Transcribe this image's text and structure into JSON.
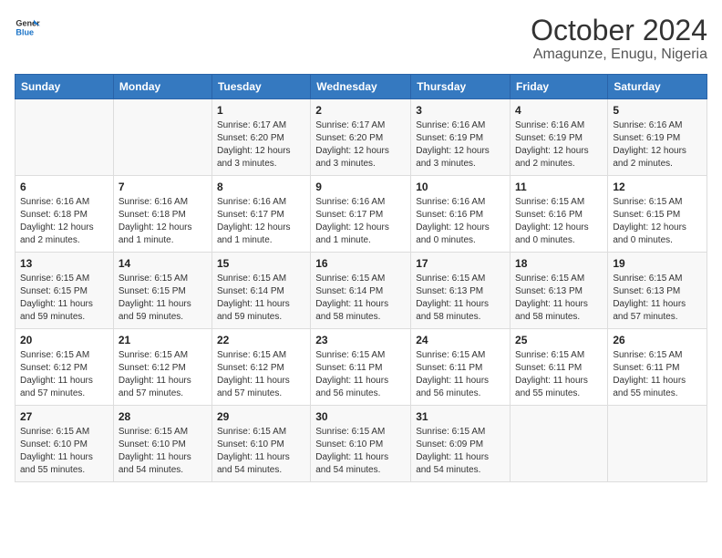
{
  "logo": {
    "line1": "General",
    "line2": "Blue"
  },
  "title": {
    "month_year": "October 2024",
    "location": "Amagunze, Enugu, Nigeria"
  },
  "header_days": [
    "Sunday",
    "Monday",
    "Tuesday",
    "Wednesday",
    "Thursday",
    "Friday",
    "Saturday"
  ],
  "weeks": [
    [
      {
        "day": "",
        "info": ""
      },
      {
        "day": "",
        "info": ""
      },
      {
        "day": "1",
        "info": "Sunrise: 6:17 AM\nSunset: 6:20 PM\nDaylight: 12 hours and 3 minutes."
      },
      {
        "day": "2",
        "info": "Sunrise: 6:17 AM\nSunset: 6:20 PM\nDaylight: 12 hours and 3 minutes."
      },
      {
        "day": "3",
        "info": "Sunrise: 6:16 AM\nSunset: 6:19 PM\nDaylight: 12 hours and 3 minutes."
      },
      {
        "day": "4",
        "info": "Sunrise: 6:16 AM\nSunset: 6:19 PM\nDaylight: 12 hours and 2 minutes."
      },
      {
        "day": "5",
        "info": "Sunrise: 6:16 AM\nSunset: 6:19 PM\nDaylight: 12 hours and 2 minutes."
      }
    ],
    [
      {
        "day": "6",
        "info": "Sunrise: 6:16 AM\nSunset: 6:18 PM\nDaylight: 12 hours and 2 minutes."
      },
      {
        "day": "7",
        "info": "Sunrise: 6:16 AM\nSunset: 6:18 PM\nDaylight: 12 hours and 1 minute."
      },
      {
        "day": "8",
        "info": "Sunrise: 6:16 AM\nSunset: 6:17 PM\nDaylight: 12 hours and 1 minute."
      },
      {
        "day": "9",
        "info": "Sunrise: 6:16 AM\nSunset: 6:17 PM\nDaylight: 12 hours and 1 minute."
      },
      {
        "day": "10",
        "info": "Sunrise: 6:16 AM\nSunset: 6:16 PM\nDaylight: 12 hours and 0 minutes."
      },
      {
        "day": "11",
        "info": "Sunrise: 6:15 AM\nSunset: 6:16 PM\nDaylight: 12 hours and 0 minutes."
      },
      {
        "day": "12",
        "info": "Sunrise: 6:15 AM\nSunset: 6:15 PM\nDaylight: 12 hours and 0 minutes."
      }
    ],
    [
      {
        "day": "13",
        "info": "Sunrise: 6:15 AM\nSunset: 6:15 PM\nDaylight: 11 hours and 59 minutes."
      },
      {
        "day": "14",
        "info": "Sunrise: 6:15 AM\nSunset: 6:15 PM\nDaylight: 11 hours and 59 minutes."
      },
      {
        "day": "15",
        "info": "Sunrise: 6:15 AM\nSunset: 6:14 PM\nDaylight: 11 hours and 59 minutes."
      },
      {
        "day": "16",
        "info": "Sunrise: 6:15 AM\nSunset: 6:14 PM\nDaylight: 11 hours and 58 minutes."
      },
      {
        "day": "17",
        "info": "Sunrise: 6:15 AM\nSunset: 6:13 PM\nDaylight: 11 hours and 58 minutes."
      },
      {
        "day": "18",
        "info": "Sunrise: 6:15 AM\nSunset: 6:13 PM\nDaylight: 11 hours and 58 minutes."
      },
      {
        "day": "19",
        "info": "Sunrise: 6:15 AM\nSunset: 6:13 PM\nDaylight: 11 hours and 57 minutes."
      }
    ],
    [
      {
        "day": "20",
        "info": "Sunrise: 6:15 AM\nSunset: 6:12 PM\nDaylight: 11 hours and 57 minutes."
      },
      {
        "day": "21",
        "info": "Sunrise: 6:15 AM\nSunset: 6:12 PM\nDaylight: 11 hours and 57 minutes."
      },
      {
        "day": "22",
        "info": "Sunrise: 6:15 AM\nSunset: 6:12 PM\nDaylight: 11 hours and 57 minutes."
      },
      {
        "day": "23",
        "info": "Sunrise: 6:15 AM\nSunset: 6:11 PM\nDaylight: 11 hours and 56 minutes."
      },
      {
        "day": "24",
        "info": "Sunrise: 6:15 AM\nSunset: 6:11 PM\nDaylight: 11 hours and 56 minutes."
      },
      {
        "day": "25",
        "info": "Sunrise: 6:15 AM\nSunset: 6:11 PM\nDaylight: 11 hours and 55 minutes."
      },
      {
        "day": "26",
        "info": "Sunrise: 6:15 AM\nSunset: 6:11 PM\nDaylight: 11 hours and 55 minutes."
      }
    ],
    [
      {
        "day": "27",
        "info": "Sunrise: 6:15 AM\nSunset: 6:10 PM\nDaylight: 11 hours and 55 minutes."
      },
      {
        "day": "28",
        "info": "Sunrise: 6:15 AM\nSunset: 6:10 PM\nDaylight: 11 hours and 54 minutes."
      },
      {
        "day": "29",
        "info": "Sunrise: 6:15 AM\nSunset: 6:10 PM\nDaylight: 11 hours and 54 minutes."
      },
      {
        "day": "30",
        "info": "Sunrise: 6:15 AM\nSunset: 6:10 PM\nDaylight: 11 hours and 54 minutes."
      },
      {
        "day": "31",
        "info": "Sunrise: 6:15 AM\nSunset: 6:09 PM\nDaylight: 11 hours and 54 minutes."
      },
      {
        "day": "",
        "info": ""
      },
      {
        "day": "",
        "info": ""
      }
    ]
  ]
}
